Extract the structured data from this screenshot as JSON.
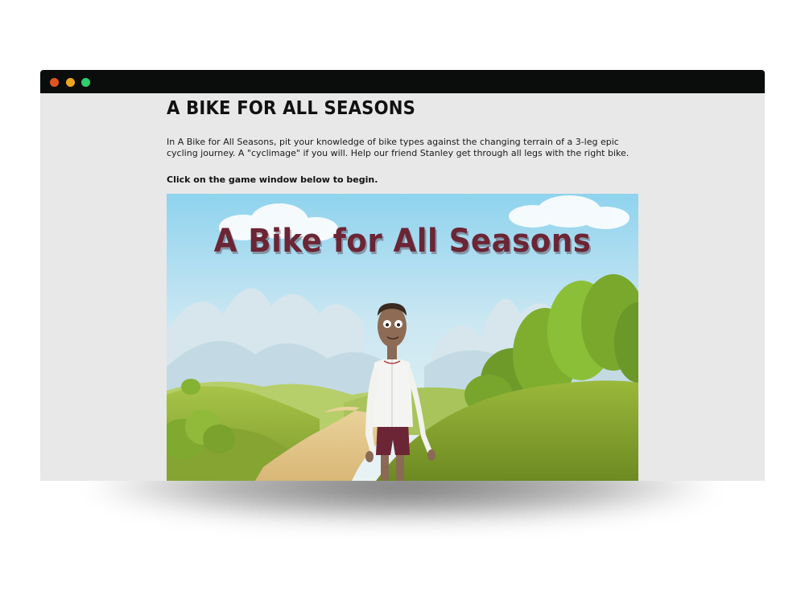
{
  "window": {
    "controls": [
      "close",
      "minimize",
      "maximize"
    ],
    "colors": {
      "close": "#e2541e",
      "minimize": "#efa51c",
      "maximize": "#2fcf6f",
      "titlebar": "#0b0d0d",
      "page_bg": "#e8e8e8"
    }
  },
  "page": {
    "title": "A BIKE FOR ALL SEASONS",
    "intro": "In A Bike for All Seasons, pit your knowledge of bike types against the changing terrain of a 3-leg epic cycling journey. A \"cyclimage\" if you will. Help our friend Stanley get through all legs with the right bike.",
    "cta": "Click on the game window below to begin."
  },
  "game": {
    "title": "A Bike for All Seasons",
    "title_color": "#6b2535"
  }
}
